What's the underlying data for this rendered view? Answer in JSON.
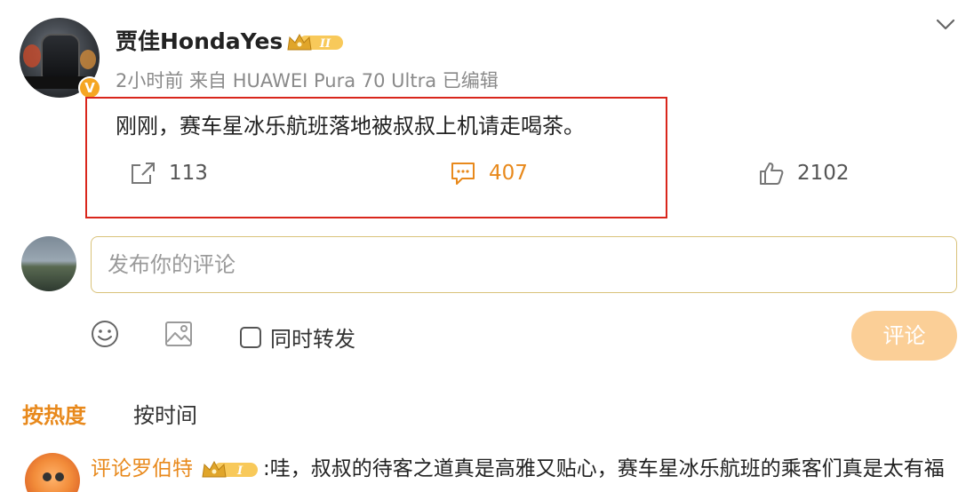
{
  "post": {
    "username": "贾佳HondaYes",
    "verified_badge": "V",
    "meta": "2小时前 来自 HUAWEI Pura 70 Ultra 已编辑",
    "text": "刚刚，赛车星冰乐航班落地被叔叔上机请走喝茶。",
    "reposts": "113",
    "comments": "407",
    "likes": "2102",
    "level_badge": "II"
  },
  "composer": {
    "placeholder": "发布你的评论",
    "repost_label": "同时转发",
    "submit_label": "评论"
  },
  "sort_tabs": {
    "hot": "按热度",
    "time": "按时间"
  },
  "comments": [
    {
      "name": "评论罗伯特",
      "level_badge": "I",
      "text": ":哇，叔叔的待客之道真是高雅又贴心，赛车星冰乐航班的乘客们真是太有福"
    }
  ],
  "icons": {
    "repost": "repost-icon",
    "comment": "comment-icon",
    "like": "thumbs-up-icon",
    "emoji": "emoji-icon",
    "image": "image-icon",
    "more": "chevron-down-icon",
    "crown": "crown-icon"
  },
  "colors": {
    "accent": "#e8891c",
    "highlight_border": "#d9261c",
    "submit_bg": "#fbcf97",
    "verified": "#f5a623"
  }
}
